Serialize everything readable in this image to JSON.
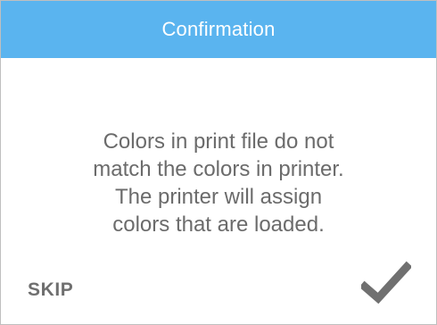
{
  "dialog": {
    "title": "Confirmation",
    "message_lines": [
      "Colors in print file do not",
      "match the colors in printer.",
      "The printer will assign",
      "colors that are loaded."
    ],
    "skip_label": "SKIP",
    "confirm_icon": "checkmark-icon"
  },
  "colors": {
    "header": "#5ab4ef",
    "text": "#6b6b6b",
    "icon": "#707070"
  }
}
